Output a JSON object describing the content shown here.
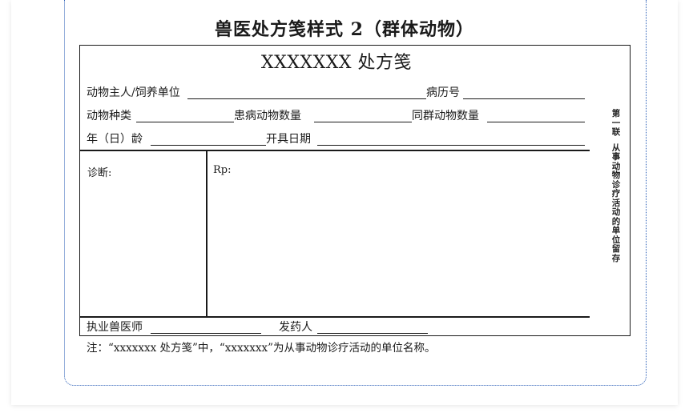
{
  "document": {
    "title": "兽医处方笺样式 2（群体动物）",
    "form_title": "XXXXXXX 处方笺",
    "fields": {
      "owner": "动物主人/饲养单位",
      "case_no": "病历号",
      "species": "动物种类",
      "sick_count": "患病动物数量",
      "herd_count": "同群动物数量",
      "age": "年（日）龄",
      "issue_date": "开具日期"
    },
    "diagnosis_label": "诊断:",
    "rp_label": "Rp:",
    "vet_label": "执业兽医师",
    "dispenser_label": "发药人",
    "side_copy_label": [
      "第",
      "一",
      "联"
    ],
    "side_copy_text": [
      "从",
      "事",
      "动",
      "物",
      "诊",
      "疗",
      "活",
      "动",
      "的",
      "单",
      "位",
      "留",
      "存"
    ],
    "note": "注：“xxxxxxx 处方笺”中，“xxxxxxx”为从事动物诊疗活动的单位名称。"
  },
  "colors": {
    "frame_border": "#2f62b8",
    "ink": "#1a1a1a"
  }
}
